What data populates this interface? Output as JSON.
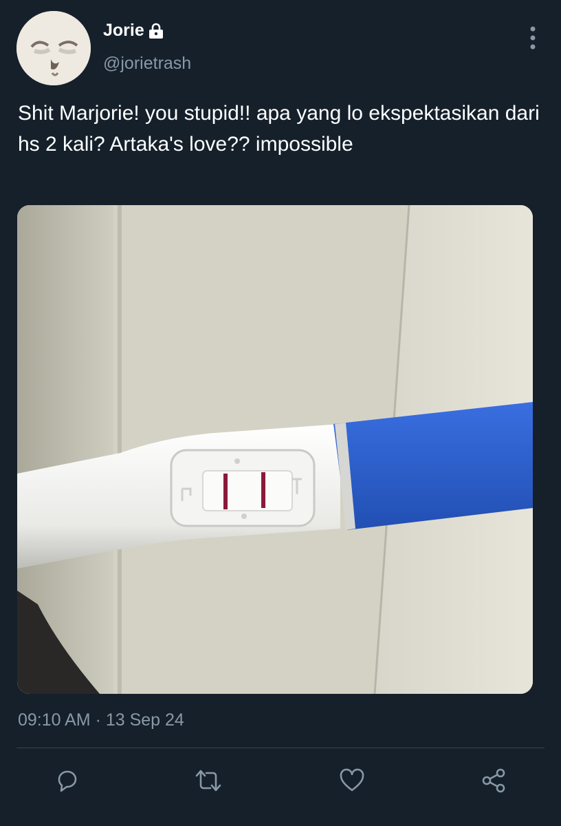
{
  "tweet": {
    "display_name": "Jorie",
    "handle": "@jorietrash",
    "text": "Shit Marjorie! you stupid!! apa yang lo ekspektasikan dari hs 2 kali? Artaka's love?? impossible",
    "timestamp": "09:10 AM · 13 Sep 24",
    "media": {
      "subject": "pregnancy test showing two lines",
      "labels": {
        "control": "C",
        "test": "T"
      }
    }
  },
  "icons": {
    "lock": "lock-icon",
    "more": "more-vertical-icon",
    "reply": "reply-icon",
    "retweet": "retweet-icon",
    "like": "heart-icon",
    "share": "share-icon"
  },
  "colors": {
    "background": "#15202b",
    "secondary_text": "#8899a6",
    "divider": "#38444d",
    "icon": "#8899a6",
    "test_blue": "#2e5fc9",
    "test_line": "#8a1a3a"
  }
}
